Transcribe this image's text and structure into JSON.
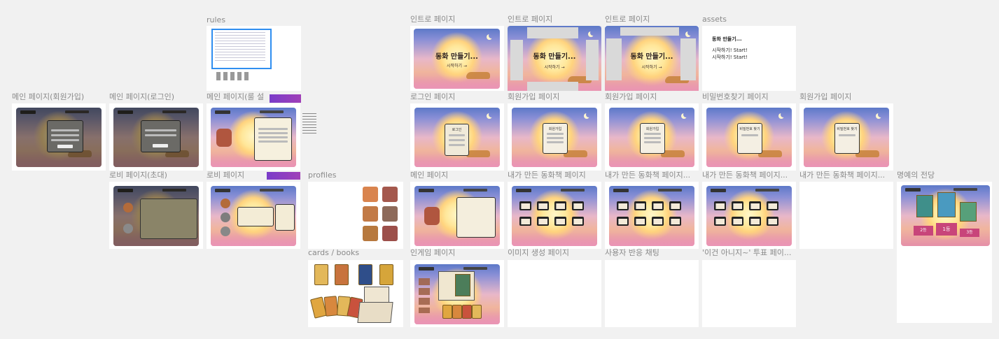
{
  "canvas": {
    "background": "#f1f1f1",
    "frames": [
      {
        "id": "rules",
        "label": "rules"
      },
      {
        "id": "intro-1",
        "label": "인트로 페이지"
      },
      {
        "id": "intro-2",
        "label": "인트로 페이지"
      },
      {
        "id": "intro-3",
        "label": "인트로 페이지"
      },
      {
        "id": "assets",
        "label": "assets"
      },
      {
        "id": "main-signup",
        "label": "메인 페이지(회원가입)"
      },
      {
        "id": "main-login",
        "label": "메인 페이지(로그인)"
      },
      {
        "id": "main-rules",
        "label": "메인 페이지(룰 설"
      },
      {
        "id": "login",
        "label": "로그인 페이지"
      },
      {
        "id": "signup-1",
        "label": "회원가입 페이지"
      },
      {
        "id": "signup-2",
        "label": "회원가입 페이지"
      },
      {
        "id": "find-password",
        "label": "비밀번호찾기 페이지"
      },
      {
        "id": "signup-3",
        "label": "회원가입 페이지"
      },
      {
        "id": "lobby-invite",
        "label": "로비 페이지(초대)"
      },
      {
        "id": "lobby",
        "label": "로비 페이지"
      },
      {
        "id": "profiles",
        "label": "profiles"
      },
      {
        "id": "main",
        "label": "메인 페이지"
      },
      {
        "id": "my-books-1",
        "label": "내가 만든 동화책 페이지"
      },
      {
        "id": "my-books-2",
        "label": "내가 만든 동화책 페이지..."
      },
      {
        "id": "my-books-3",
        "label": "내가 만든 동화책 페이지..."
      },
      {
        "id": "my-books-4",
        "label": "내가 만든 동화책 페이지..."
      },
      {
        "id": "hall-of-fame",
        "label": "명예의 전당"
      },
      {
        "id": "cards-books",
        "label": "cards / books"
      },
      {
        "id": "ingame",
        "label": "인게임 페이지"
      },
      {
        "id": "image-gen",
        "label": "이미지 생성 페이지"
      },
      {
        "id": "user-reaction",
        "label": "사용자 반응 채팅"
      },
      {
        "id": "vote",
        "label": "'이건 아니지~' 투표 페이..."
      }
    ]
  },
  "screens": {
    "game_title": "동화 만들기...",
    "start_label": "시작하기 →",
    "login_title": "로그인",
    "signup_title": "회원가입",
    "find_password_title": "비밀번호 찾기",
    "assets_text": [
      "동화 만들기...",
      "시작하기! Start!",
      "시작하기! Start!"
    ],
    "hall_ranks": [
      "2등",
      "1등",
      "3등"
    ]
  },
  "colors": {
    "selection": "#2f8ef0",
    "chip_purple": "#7a3cc9",
    "rank_pink": "#c8457a"
  }
}
